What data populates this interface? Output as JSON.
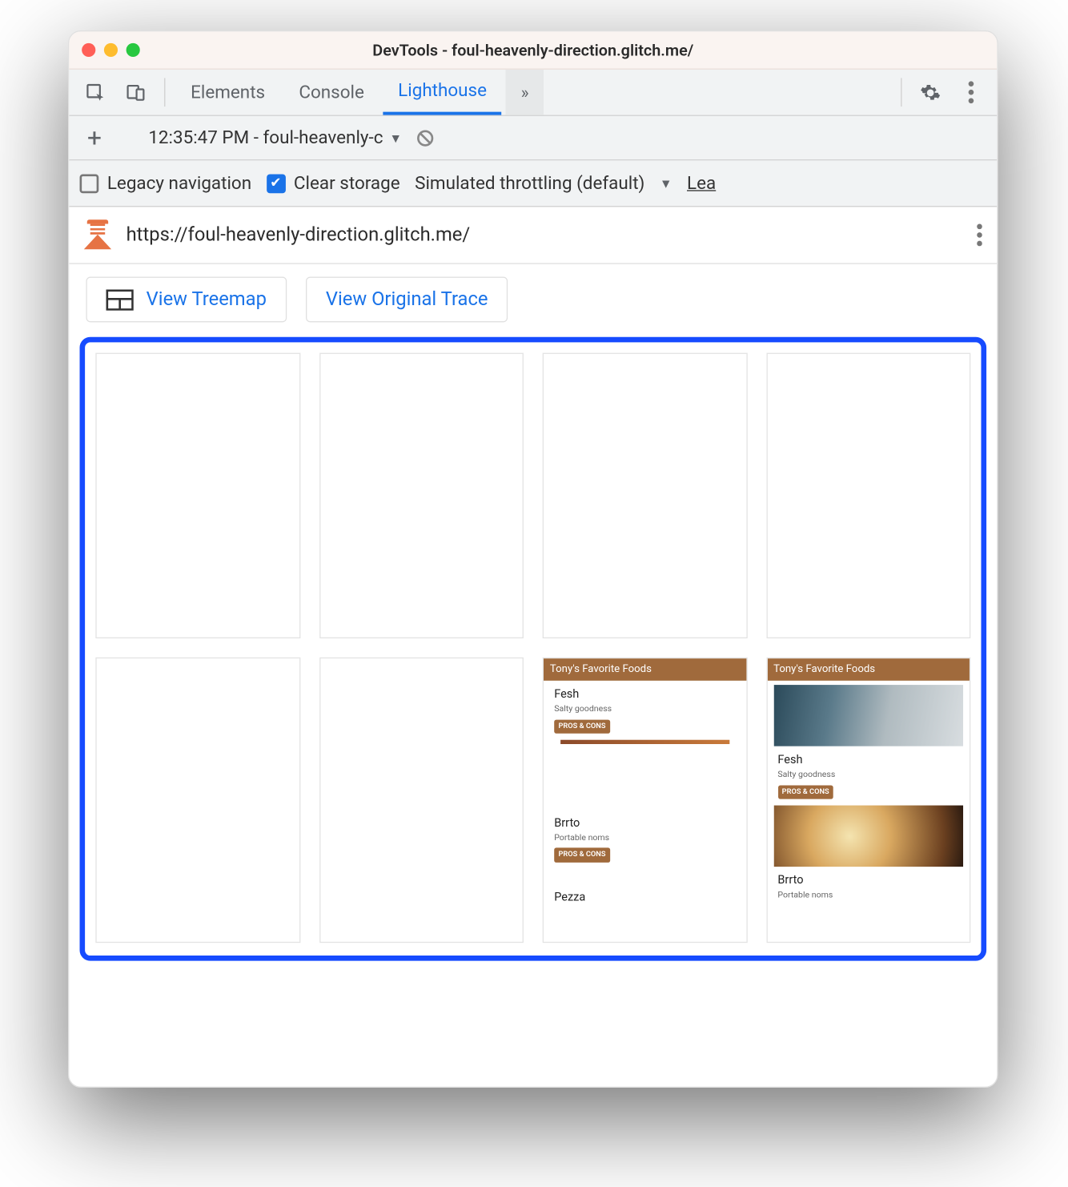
{
  "window": {
    "title": "DevTools - foul-heavenly-direction.glitch.me/"
  },
  "tabs": {
    "elements": "Elements",
    "console": "Console",
    "lighthouse": "Lighthouse"
  },
  "reportbar": {
    "selected": "12:35:47 PM - foul-heavenly-c"
  },
  "options": {
    "legacy_label": "Legacy navigation",
    "clear_label": "Clear storage",
    "throttling": "Simulated throttling (default)",
    "learn": "Lea"
  },
  "url": "https://foul-heavenly-direction.glitch.me/",
  "buttons": {
    "treemap": "View Treemap",
    "trace": "View Original Trace"
  },
  "preview": {
    "header": "Tony's Favorite Foods",
    "items": [
      {
        "name": "Fesh",
        "desc": "Salty goodness",
        "btn": "PROS & CONS"
      },
      {
        "name": "Brrto",
        "desc": "Portable noms",
        "btn": "PROS & CONS"
      },
      {
        "name": "Pezza",
        "desc": "",
        "btn": ""
      }
    ]
  }
}
